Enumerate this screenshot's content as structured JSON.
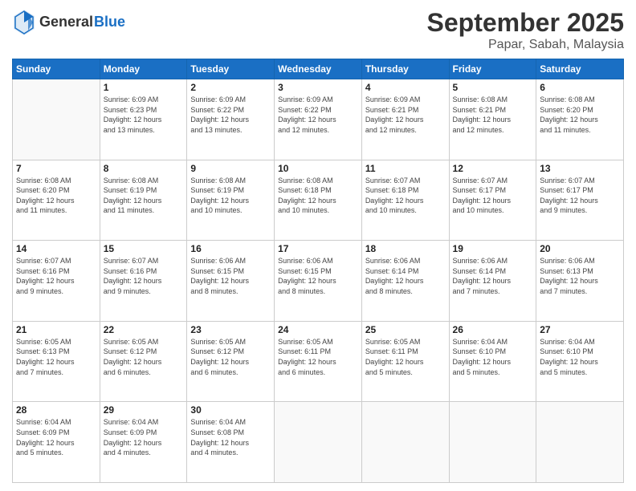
{
  "header": {
    "logo_general": "General",
    "logo_blue": "Blue",
    "month": "September 2025",
    "location": "Papar, Sabah, Malaysia"
  },
  "weekdays": [
    "Sunday",
    "Monday",
    "Tuesday",
    "Wednesday",
    "Thursday",
    "Friday",
    "Saturday"
  ],
  "weeks": [
    [
      {
        "day": "",
        "info": ""
      },
      {
        "day": "1",
        "info": "Sunrise: 6:09 AM\nSunset: 6:23 PM\nDaylight: 12 hours\nand 13 minutes."
      },
      {
        "day": "2",
        "info": "Sunrise: 6:09 AM\nSunset: 6:22 PM\nDaylight: 12 hours\nand 13 minutes."
      },
      {
        "day": "3",
        "info": "Sunrise: 6:09 AM\nSunset: 6:22 PM\nDaylight: 12 hours\nand 12 minutes."
      },
      {
        "day": "4",
        "info": "Sunrise: 6:09 AM\nSunset: 6:21 PM\nDaylight: 12 hours\nand 12 minutes."
      },
      {
        "day": "5",
        "info": "Sunrise: 6:08 AM\nSunset: 6:21 PM\nDaylight: 12 hours\nand 12 minutes."
      },
      {
        "day": "6",
        "info": "Sunrise: 6:08 AM\nSunset: 6:20 PM\nDaylight: 12 hours\nand 11 minutes."
      }
    ],
    [
      {
        "day": "7",
        "info": "Sunrise: 6:08 AM\nSunset: 6:20 PM\nDaylight: 12 hours\nand 11 minutes."
      },
      {
        "day": "8",
        "info": "Sunrise: 6:08 AM\nSunset: 6:19 PM\nDaylight: 12 hours\nand 11 minutes."
      },
      {
        "day": "9",
        "info": "Sunrise: 6:08 AM\nSunset: 6:19 PM\nDaylight: 12 hours\nand 10 minutes."
      },
      {
        "day": "10",
        "info": "Sunrise: 6:08 AM\nSunset: 6:18 PM\nDaylight: 12 hours\nand 10 minutes."
      },
      {
        "day": "11",
        "info": "Sunrise: 6:07 AM\nSunset: 6:18 PM\nDaylight: 12 hours\nand 10 minutes."
      },
      {
        "day": "12",
        "info": "Sunrise: 6:07 AM\nSunset: 6:17 PM\nDaylight: 12 hours\nand 10 minutes."
      },
      {
        "day": "13",
        "info": "Sunrise: 6:07 AM\nSunset: 6:17 PM\nDaylight: 12 hours\nand 9 minutes."
      }
    ],
    [
      {
        "day": "14",
        "info": "Sunrise: 6:07 AM\nSunset: 6:16 PM\nDaylight: 12 hours\nand 9 minutes."
      },
      {
        "day": "15",
        "info": "Sunrise: 6:07 AM\nSunset: 6:16 PM\nDaylight: 12 hours\nand 9 minutes."
      },
      {
        "day": "16",
        "info": "Sunrise: 6:06 AM\nSunset: 6:15 PM\nDaylight: 12 hours\nand 8 minutes."
      },
      {
        "day": "17",
        "info": "Sunrise: 6:06 AM\nSunset: 6:15 PM\nDaylight: 12 hours\nand 8 minutes."
      },
      {
        "day": "18",
        "info": "Sunrise: 6:06 AM\nSunset: 6:14 PM\nDaylight: 12 hours\nand 8 minutes."
      },
      {
        "day": "19",
        "info": "Sunrise: 6:06 AM\nSunset: 6:14 PM\nDaylight: 12 hours\nand 7 minutes."
      },
      {
        "day": "20",
        "info": "Sunrise: 6:06 AM\nSunset: 6:13 PM\nDaylight: 12 hours\nand 7 minutes."
      }
    ],
    [
      {
        "day": "21",
        "info": "Sunrise: 6:05 AM\nSunset: 6:13 PM\nDaylight: 12 hours\nand 7 minutes."
      },
      {
        "day": "22",
        "info": "Sunrise: 6:05 AM\nSunset: 6:12 PM\nDaylight: 12 hours\nand 6 minutes."
      },
      {
        "day": "23",
        "info": "Sunrise: 6:05 AM\nSunset: 6:12 PM\nDaylight: 12 hours\nand 6 minutes."
      },
      {
        "day": "24",
        "info": "Sunrise: 6:05 AM\nSunset: 6:11 PM\nDaylight: 12 hours\nand 6 minutes."
      },
      {
        "day": "25",
        "info": "Sunrise: 6:05 AM\nSunset: 6:11 PM\nDaylight: 12 hours\nand 5 minutes."
      },
      {
        "day": "26",
        "info": "Sunrise: 6:04 AM\nSunset: 6:10 PM\nDaylight: 12 hours\nand 5 minutes."
      },
      {
        "day": "27",
        "info": "Sunrise: 6:04 AM\nSunset: 6:10 PM\nDaylight: 12 hours\nand 5 minutes."
      }
    ],
    [
      {
        "day": "28",
        "info": "Sunrise: 6:04 AM\nSunset: 6:09 PM\nDaylight: 12 hours\nand 5 minutes."
      },
      {
        "day": "29",
        "info": "Sunrise: 6:04 AM\nSunset: 6:09 PM\nDaylight: 12 hours\nand 4 minutes."
      },
      {
        "day": "30",
        "info": "Sunrise: 6:04 AM\nSunset: 6:08 PM\nDaylight: 12 hours\nand 4 minutes."
      },
      {
        "day": "",
        "info": ""
      },
      {
        "day": "",
        "info": ""
      },
      {
        "day": "",
        "info": ""
      },
      {
        "day": "",
        "info": ""
      }
    ]
  ]
}
